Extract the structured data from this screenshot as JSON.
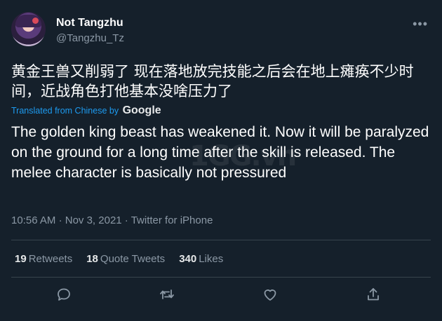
{
  "tweet": {
    "display_name": "Not Tangzhu",
    "handle": "@Tangzhu_Tz",
    "original_text": "黄金王兽又削弱了 现在落地放完技能之后会在地上瘫痪不少时间，近战角色打他基本没啥压力了",
    "translated_from": "Translated from Chinese by",
    "translator": "Google",
    "translated_text": "The golden king beast has weakened it. Now it will be paralyzed on the ground for a long time after the skill is released. The melee character is basically not pressured",
    "time": "10:56 AM",
    "date": "Nov 3, 2021",
    "source": "Twitter for iPhone",
    "separator": "·",
    "watermark": "1GG.vn"
  },
  "stats": {
    "retweets_count": "19",
    "retweets_label": "Retweets",
    "quote_count": "18",
    "quote_label": "Quote Tweets",
    "likes_count": "340",
    "likes_label": "Likes"
  },
  "icons": {
    "more": "more-icon",
    "reply": "reply-icon",
    "retweet": "retweet-icon",
    "like": "heart-icon",
    "share": "share-icon"
  },
  "colors": {
    "background": "#15202b",
    "link": "#1d9bf0",
    "secondary_text": "#8b98a5"
  }
}
